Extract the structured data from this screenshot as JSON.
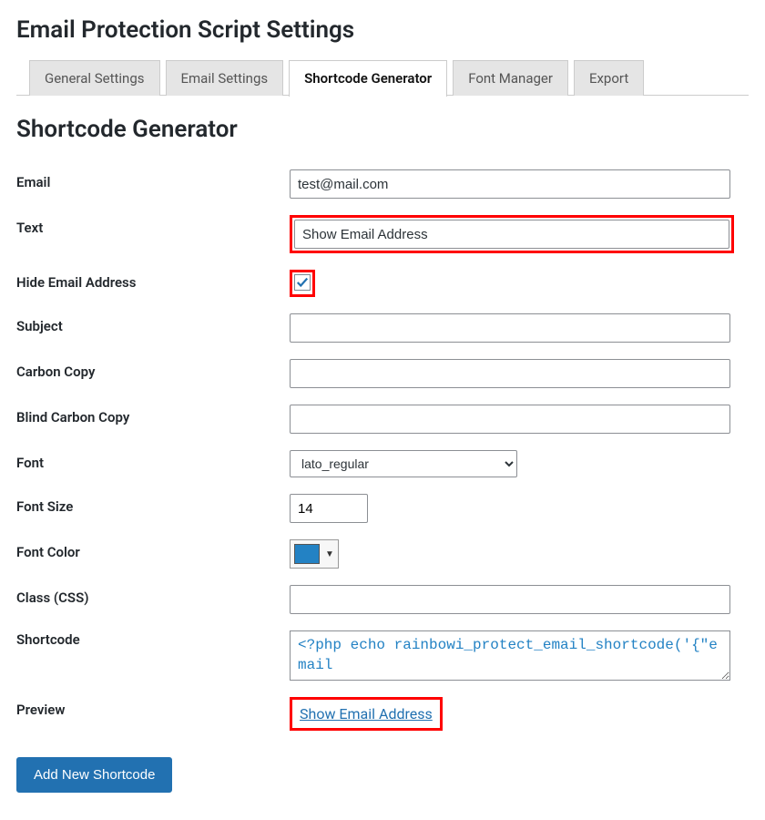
{
  "page_title": "Email Protection Script Settings",
  "tabs": [
    {
      "label": "General Settings"
    },
    {
      "label": "Email Settings"
    },
    {
      "label": "Shortcode Generator"
    },
    {
      "label": "Font Manager"
    },
    {
      "label": "Export"
    }
  ],
  "section_title": "Shortcode Generator",
  "form": {
    "email": {
      "label": "Email",
      "value": "test@mail.com"
    },
    "text": {
      "label": "Text",
      "value": "Show Email Address"
    },
    "hide": {
      "label": "Hide Email Address",
      "checked": true
    },
    "subject": {
      "label": "Subject",
      "value": ""
    },
    "cc": {
      "label": "Carbon Copy",
      "value": ""
    },
    "bcc": {
      "label": "Blind Carbon Copy",
      "value": ""
    },
    "font": {
      "label": "Font",
      "value": "lato_regular"
    },
    "font_size": {
      "label": "Font Size",
      "value": "14"
    },
    "font_color": {
      "label": "Font Color",
      "value": "#2382c4"
    },
    "class": {
      "label": "Class (CSS)",
      "value": ""
    },
    "shortcode": {
      "label": "Shortcode",
      "value": "<?php echo rainbowi_protect_email_shortcode('{\"email"
    },
    "preview": {
      "label": "Preview",
      "link_text": "Show Email Address"
    }
  },
  "submit_label": "Add New Shortcode"
}
